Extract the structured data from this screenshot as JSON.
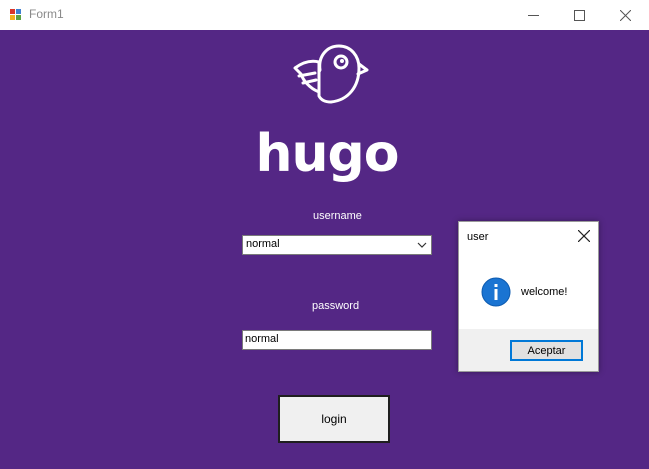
{
  "window": {
    "title": "Form1"
  },
  "brand": {
    "name": "hugo"
  },
  "form": {
    "username_label": "username",
    "username_value": "normal",
    "password_label": "password",
    "password_value": "normal",
    "login_label": "login"
  },
  "dialog": {
    "title": "user",
    "message": "welcome!",
    "ok_label": "Aceptar"
  },
  "colors": {
    "background": "#542785",
    "dialog_accent": "#0078d7"
  },
  "icons": [
    "app-icon",
    "minimize-icon",
    "maximize-icon",
    "close-icon",
    "bird-logo",
    "chevron-down-icon",
    "info-icon"
  ]
}
